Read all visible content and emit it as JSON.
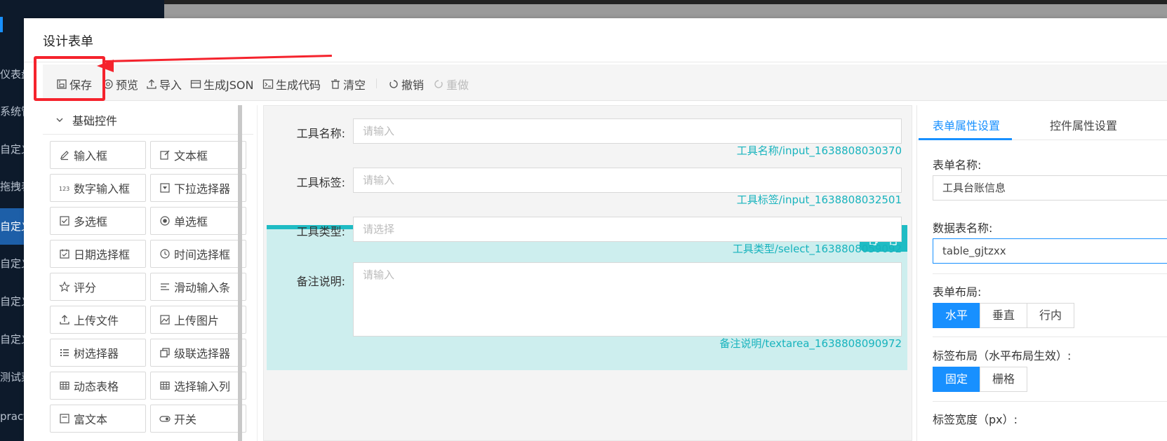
{
  "background_nav": {
    "items": [
      "仪表盘",
      "系统管理",
      "自定义",
      "拖拽表单",
      "自定义",
      "自定义",
      "自定义",
      "自定义",
      "测试菜单",
      "practice"
    ],
    "active_index": 4
  },
  "dialog": {
    "title": "设计表单"
  },
  "toolbar": {
    "save": "保存",
    "preview": "预览",
    "import": "导入",
    "gen_json": "生成JSON",
    "gen_code": "生成代码",
    "clear": "清空",
    "undo": "撤销",
    "redo": "重做"
  },
  "left_panel": {
    "group_title": "基础控件",
    "components": [
      {
        "label": "输入框",
        "icon": "edit-icon"
      },
      {
        "label": "文本框",
        "icon": "edit-box-icon"
      },
      {
        "label": "数字输入框",
        "icon": "number-123-icon"
      },
      {
        "label": "下拉选择器",
        "icon": "dropdown-icon"
      },
      {
        "label": "多选框",
        "icon": "checkbox-icon"
      },
      {
        "label": "单选框",
        "icon": "radio-icon"
      },
      {
        "label": "日期选择框",
        "icon": "calendar-icon"
      },
      {
        "label": "时间选择框",
        "icon": "clock-icon"
      },
      {
        "label": "评分",
        "icon": "star-icon"
      },
      {
        "label": "滑动输入条",
        "icon": "slider-icon"
      },
      {
        "label": "上传文件",
        "icon": "upload-icon"
      },
      {
        "label": "上传图片",
        "icon": "image-icon"
      },
      {
        "label": "树选择器",
        "icon": "tree-icon"
      },
      {
        "label": "级联选择器",
        "icon": "cascader-icon"
      },
      {
        "label": "动态表格",
        "icon": "table-icon"
      },
      {
        "label": "选择输入列",
        "icon": "table-icon"
      },
      {
        "label": "富文本",
        "icon": "richtext-icon"
      },
      {
        "label": "开关",
        "icon": "switch-icon"
      }
    ]
  },
  "canvas": {
    "fields": [
      {
        "label": "工具名称:",
        "placeholder": "请输入",
        "caption": "工具名称/input_1638808030370"
      },
      {
        "label": "工具标签:",
        "placeholder": "请输入",
        "caption": "工具标签/input_1638808032501"
      },
      {
        "label": "工具类型:",
        "placeholder": "请选择",
        "caption": "工具类型/select_1638808059092"
      },
      {
        "label": "备注说明:",
        "placeholder": "请输入",
        "caption": "备注说明/textarea_1638808090972"
      }
    ]
  },
  "right_panel": {
    "tabs": [
      "表单属性设置",
      "控件属性设置"
    ],
    "active_tab": 0,
    "form_name_label": "表单名称:",
    "form_name_value": "工具台账信息",
    "table_name_label": "数据表名称:",
    "table_name_value": "table_gjtzxx",
    "layout_label": "表单布局:",
    "layout_options": [
      "水平",
      "垂直",
      "行内"
    ],
    "layout_active": 0,
    "label_layout_label": "标签布局（水平布局生效）:",
    "label_layout_options": [
      "固定",
      "栅格"
    ],
    "label_layout_active": 0,
    "label_width_label": "标签宽度（px）:"
  },
  "colors": {
    "accent": "#1890ff",
    "selected_teal": "#1fbcc4",
    "annotation_red": "#f5232d"
  }
}
